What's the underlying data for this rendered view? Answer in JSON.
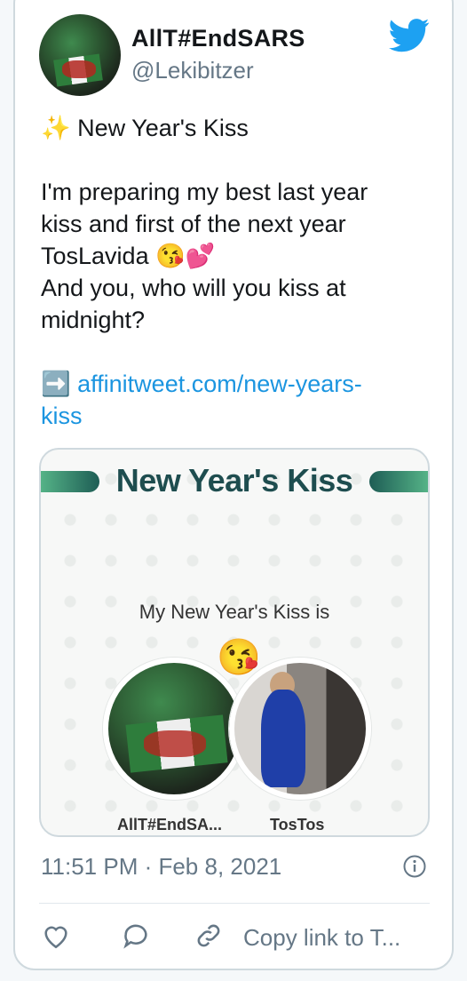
{
  "tweet": {
    "display_name": "AllT#EndSARS",
    "handle": "@Lekibitzer",
    "line1_emoji": "✨",
    "line1": "New Year's Kiss",
    "body_lines": [
      "I'm preparing my best last year",
      "kiss and first of the next year",
      "TosLavida",
      "And you, who will you kiss at",
      "midnight?"
    ],
    "emojis_after_toslavida": "😘💕",
    "link_emoji": "➡️",
    "link_line1": "affinitweet.com/new-years-",
    "link_line2": "kiss",
    "timestamp": "11:51 PM · Feb 8, 2021"
  },
  "preview": {
    "banner_title": "New Year's Kiss",
    "kiss_line": "My New Year's Kiss is",
    "kiss_emoji": "😘",
    "left_name": "AllT#EndSA...",
    "right_name": "TosTos"
  },
  "actions": {
    "copy_link": "Copy link to T..."
  },
  "colors": {
    "link": "#1b95e0",
    "secondary_text": "#657786",
    "banner_dark": "#1e4d4f",
    "twitter_blue": "#1da1f2"
  }
}
